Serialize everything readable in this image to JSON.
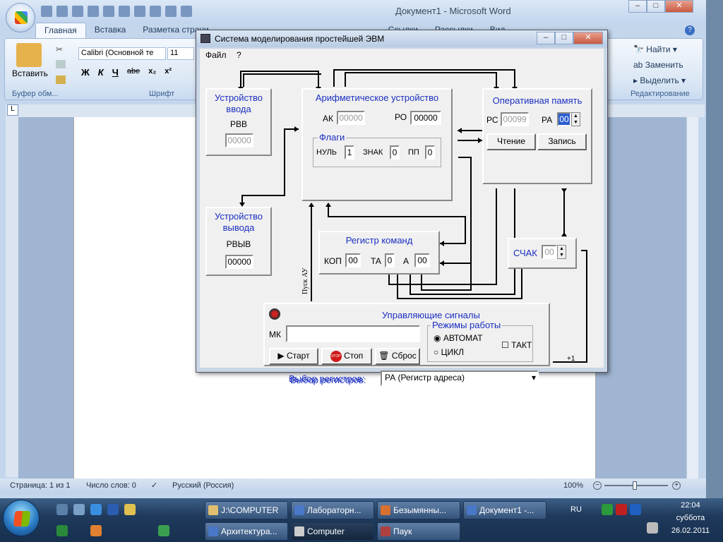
{
  "word": {
    "title": "Документ1 - Microsoft Word",
    "tabs": [
      "Главная",
      "Вставка",
      "Разметка страни",
      "Ссылки",
      "Рассылки",
      "Вид"
    ],
    "font_name": "Calibri (Основной те",
    "font_size": "11",
    "paste_label": "Вставить",
    "group_clipboard": "Буфер обм...",
    "group_font": "Шрифт",
    "group_edit": "Редактирование",
    "find": "Найти",
    "replace": "Заменить",
    "select": "Выделить",
    "status": {
      "page": "Страница: 1 из 1",
      "words": "Число слов: 0",
      "lang": "Русский (Россия)",
      "zoom": "100%"
    }
  },
  "sim": {
    "title": "Система моделирования простейшей ЭВМ",
    "menu": [
      "Файл",
      "?"
    ],
    "input_dev": {
      "title1": "Устройство",
      "title2": "ввода",
      "label": "РВВ",
      "value": "00000"
    },
    "output_dev": {
      "title1": "Устройство",
      "title2": "вывода",
      "label": "РВЫВ",
      "value": "00000"
    },
    "alu": {
      "title": "Арифметическое устройство",
      "ak_label": "АК",
      "ak_value": "00000",
      "ro_label": "РО",
      "ro_value": "00000",
      "flags_title": "Флаги",
      "zero_label": "НУЛЬ",
      "zero_value": "1",
      "sign_label": "ЗНАК",
      "sign_value": "0",
      "ovf_label": "ПП",
      "ovf_value": "0"
    },
    "ram": {
      "title": "Оперативная память",
      "rs_label": "РС",
      "rs_value": "00099",
      "ra_label": "РА",
      "ra_value": "00",
      "read": "Чтение",
      "write": "Запись"
    },
    "cmd_reg": {
      "title": "Регистр команд",
      "kop_label": "КОП",
      "kop_value": "00",
      "ta_label": "ТА",
      "ta_value": "0",
      "a_label": "А",
      "a_value": "00"
    },
    "counter": {
      "label": "СЧАК",
      "value": "00"
    },
    "start_ad": "Пуск АУ",
    "plus_one": "+1",
    "control": {
      "title": "Управляющие сигналы",
      "mk_label": "МК",
      "start": "Старт",
      "stop": "Стоп",
      "reset": "Сброс",
      "modes_title": "Режимы работы",
      "mode_auto": "АВТОМАТ",
      "mode_cycle": "ЦИКЛ",
      "mode_step": "ТАКТ",
      "reg_select_label": "Выбор регистров:",
      "reg_select_value": "РА (Регистр адреса)"
    }
  },
  "taskbar": {
    "row1": [
      "J:\\COMPUTER",
      "Лабораторн...",
      "Безымянны...",
      "Документ1 -..."
    ],
    "row2": [
      "Архитектура...",
      "Computer",
      "Паук"
    ],
    "lang": "RU",
    "time": "22:04",
    "day": "суббота",
    "date": "26.02.2011"
  }
}
